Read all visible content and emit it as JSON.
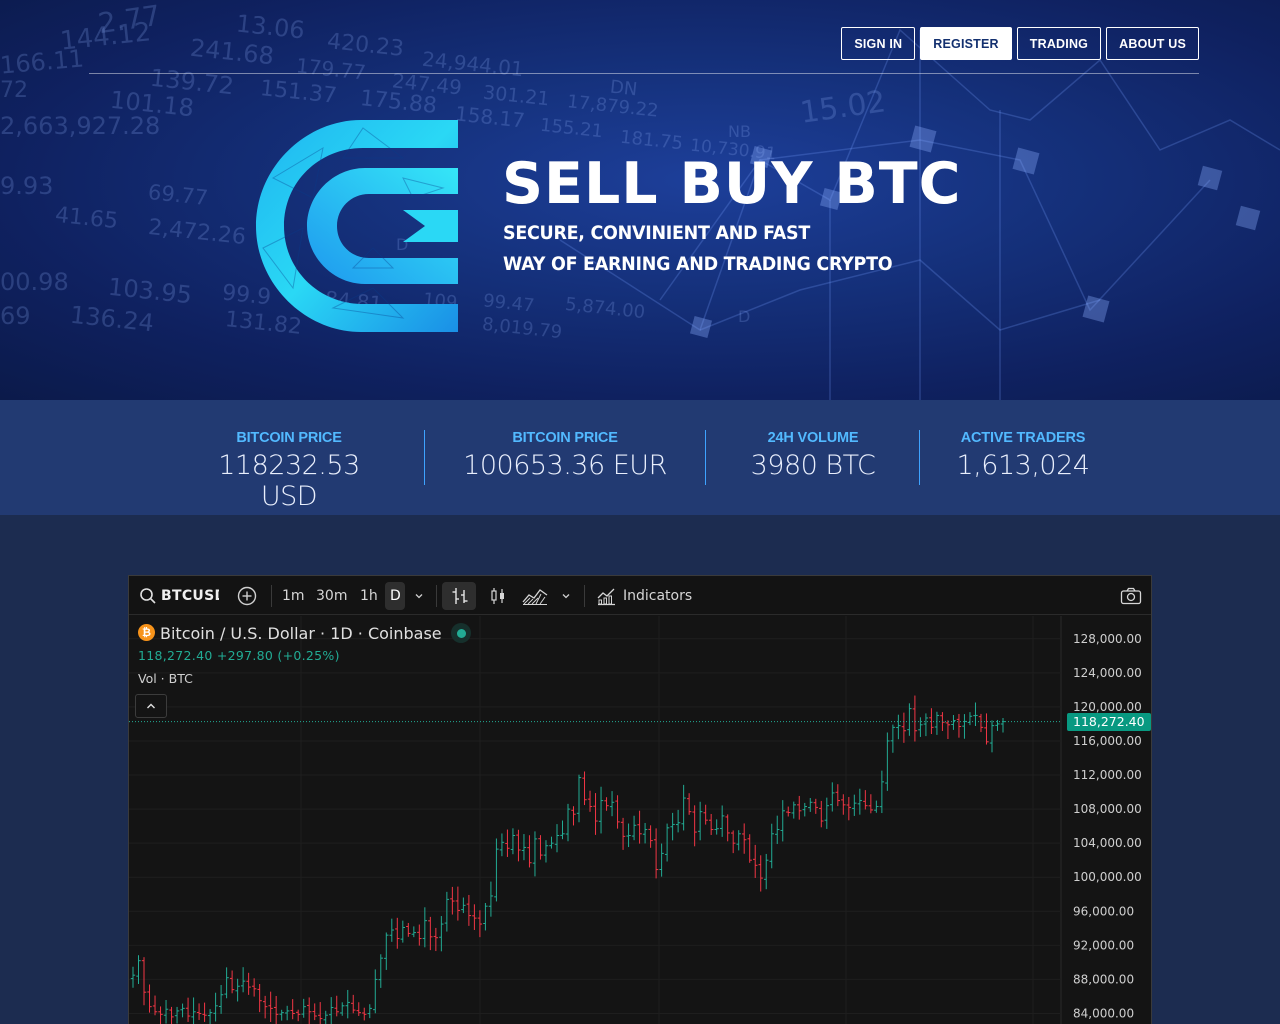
{
  "nav": {
    "buttons": [
      {
        "label": "SIGN IN",
        "active": false
      },
      {
        "label": "REGISTER",
        "active": true
      },
      {
        "label": "TRADING",
        "active": false
      },
      {
        "label": "ABOUT US",
        "active": false
      }
    ]
  },
  "hero": {
    "title": "SELL BUY BTC",
    "subtitle_line1": "SECURE, CONVINIENT AND FAST",
    "subtitle_line2": "WAY OF EARNING AND TRADING CRYPTO",
    "logo_icon": "cex-logo-icon",
    "background_numbers": [
      "2.77",
      "13.06",
      "420.23",
      "24,944.01",
      "144.12",
      "241.68",
      "179.77",
      "247.49",
      "301.21",
      "DN",
      "166.11",
      "139.72",
      "151.37",
      "175.88",
      "158.17",
      "17,879.22",
      "72",
      "101.18",
      "155.21",
      "181.75",
      "NB",
      "2,663,927.28",
      "10,730.91",
      "15.02",
      "9.93",
      "69.77",
      "41.65",
      "2,472.26",
      "D",
      "00.98",
      "103.95",
      "99.9",
      "84.81",
      "109",
      "99.47",
      "5,874.00",
      "69",
      "136.24",
      "131.82",
      "8,019.79",
      "D"
    ]
  },
  "stats": [
    {
      "label": "BITCOIN PRICE",
      "value": "118232.53 USD"
    },
    {
      "label": "BITCOIN PRICE",
      "value": "100653.36 EUR"
    },
    {
      "label": "24H VOLUME",
      "value": "3980 BTC"
    },
    {
      "label": "ACTIVE TRADERS",
      "value": "1,613,024"
    }
  ],
  "colors": {
    "accent": "#52b9ff",
    "candle_up": "#22ab94",
    "candle_down": "#f23645",
    "price_tag": "#089981"
  },
  "toolbar": {
    "symbol": "BTCUSD",
    "intervals": [
      "1m",
      "30m",
      "1h",
      "D"
    ],
    "selected_interval": "D",
    "indicators_label": "Indicators",
    "icons": [
      "search-icon",
      "add-symbol-icon",
      "chevron-down-icon",
      "bar-style-icon",
      "candle-style-icon",
      "area-style-icon",
      "chevron-down-icon",
      "indicators-icon",
      "camera-icon"
    ]
  },
  "legend": {
    "title": "Bitcoin / U.S. Dollar · 1D · Coinbase",
    "ohlc": "118,272.40 +297.80 (+0.25%)",
    "vol": "Vol · BTC",
    "coin_glyph": "₿"
  },
  "chart_data": {
    "type": "ohlc",
    "title": "Bitcoin / U.S. Dollar · 1D · Coinbase",
    "xlabel": "",
    "ylabel": "",
    "ylim": [
      83000,
      129500
    ],
    "y_ticks": [
      "128,000.00",
      "124,000.00",
      "120,000.00",
      "116,000.00",
      "112,000.00",
      "108,000.00",
      "104,000.00",
      "100,000.00",
      "96,000.00",
      "92,000.00",
      "88,000.00",
      "84,000.00"
    ],
    "last_price": 118272.4,
    "last_price_label": "118,272.40",
    "grid": true,
    "close_series": [
      88500,
      90200,
      86500,
      84800,
      84200,
      83900,
      84500,
      83600,
      84300,
      84600,
      83700,
      84200,
      84000,
      83800,
      84100,
      84900,
      86200,
      88200,
      86800,
      87200,
      87800,
      87100,
      86900,
      85500,
      84800,
      84600,
      83900,
      84100,
      84300,
      84000,
      83900,
      84800,
      84200,
      83700,
      83400,
      83800,
      84700,
      84200,
      84900,
      85300,
      84400,
      84100,
      83900,
      84600,
      88000,
      90500,
      93200,
      93800,
      92800,
      94100,
      93400,
      93500,
      92800,
      94900,
      93000,
      92900,
      94500,
      97400,
      97200,
      96100,
      96700,
      95500,
      95200,
      94500,
      96600,
      97800,
      103300,
      104100,
      103400,
      104900,
      103200,
      103500,
      101700,
      104500,
      102600,
      103700,
      104000,
      104900,
      105100,
      108000,
      107400,
      111700,
      109100,
      108300,
      106600,
      109000,
      108400,
      108800,
      106500,
      104800,
      104900,
      106100,
      105100,
      105600,
      104300,
      100900,
      102800,
      105800,
      106200,
      106400,
      109300,
      107700,
      105300,
      107700,
      106700,
      105600,
      105700,
      107200,
      105200,
      104000,
      105100,
      104400,
      102000,
      101400,
      99900,
      102000,
      105100,
      105600,
      107800,
      107600,
      108500,
      107800,
      108300,
      108800,
      108200,
      106600,
      108400,
      109900,
      109000,
      108500,
      108200,
      108700,
      109000,
      108400,
      107900,
      108300,
      111200,
      116000,
      117600,
      117800,
      117200,
      119800,
      117200,
      117900,
      118700,
      117600,
      119000,
      118200,
      117900,
      118400,
      117700,
      118300,
      118900,
      119000,
      117600,
      115900,
      117800,
      118000,
      118272
    ]
  }
}
